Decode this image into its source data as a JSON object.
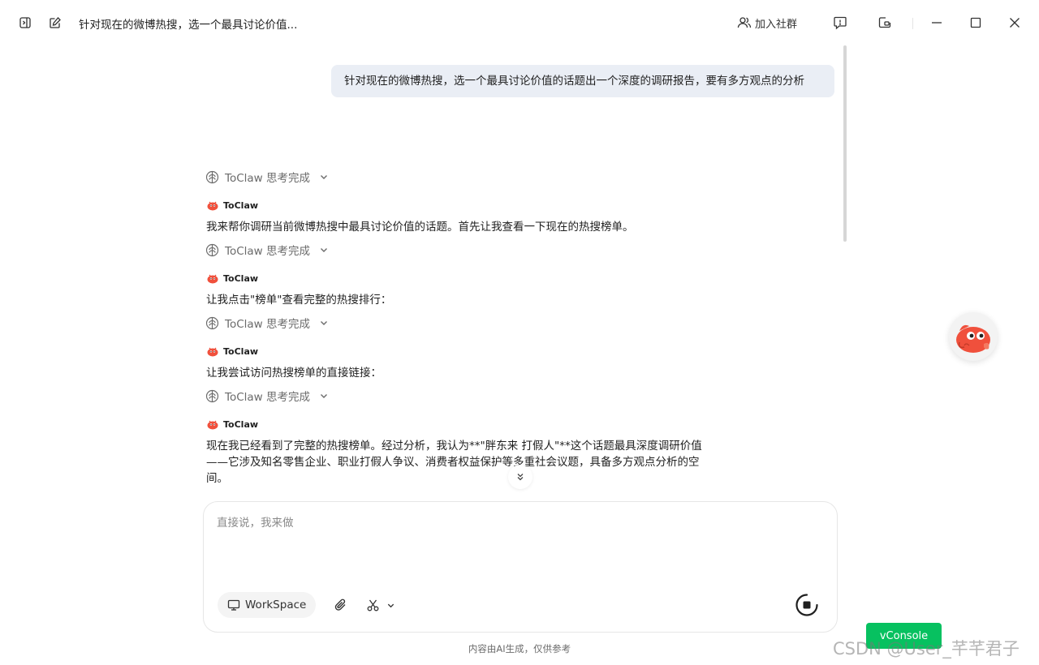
{
  "titlebar": {
    "title": "针对现在的微博热搜，选一个最具讨论价值...",
    "join_label": "加入社群"
  },
  "user_message": "针对现在的微博热搜，选一个最具讨论价值的话题出一个深度的调研报告，要有多方观点的分析",
  "assistant_name": "ToClaw",
  "thinking_label": "ToClaw 思考完成",
  "messages": [
    "我来帮你调研当前微博热搜中最具讨论价值的话题。首先让我查看一下现在的热搜榜单。",
    "让我点击\"榜单\"查看完整的热搜排行：",
    "让我尝试访问热搜榜单的直接链接：",
    "现在我已经看到了完整的热搜榜单。经过分析，我认为**\"胖东来 打假人\"**这个话题最具深度调研价值——它涉及知名零售企业、职业打假人争议、消费者权益保护等多重社会议题，具备多方观点分析的空间。"
  ],
  "composer": {
    "placeholder": "直接说，我来做",
    "workspace_label": "WorkSpace"
  },
  "footer_note": "内容由AI生成，仅供参考",
  "vconsole_label": "vConsole",
  "watermark": "CSDN @User_芊芊君子",
  "colors": {
    "user_bubble": "#eaeef5",
    "vconsole": "#07c160",
    "mascot_red": "#f0503c"
  }
}
